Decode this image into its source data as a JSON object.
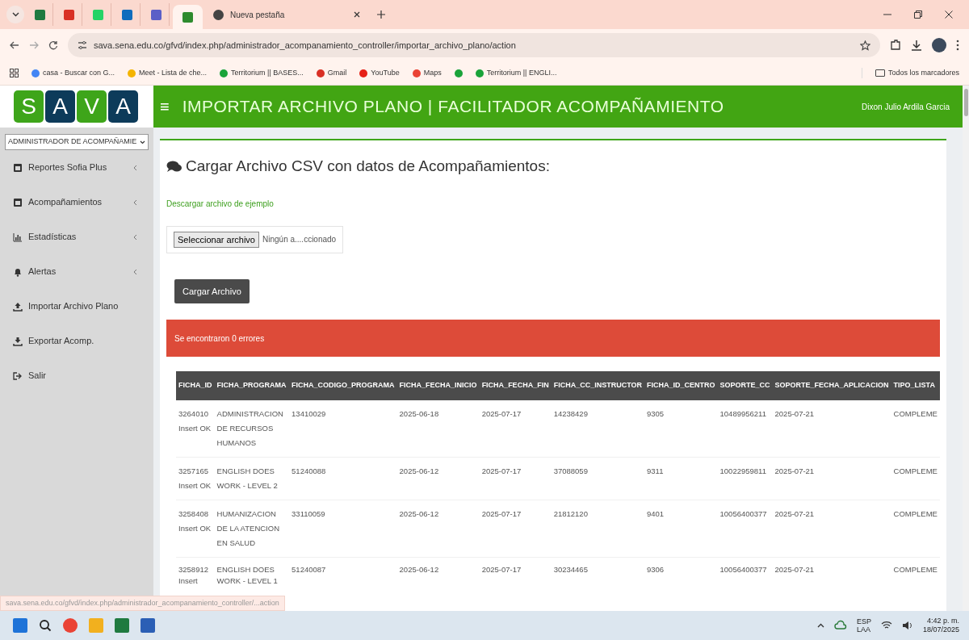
{
  "browser": {
    "tabs": [
      {
        "kind": "excel",
        "selected": false
      },
      {
        "kind": "gmail",
        "selected": false
      },
      {
        "kind": "whatsapp",
        "selected": false
      },
      {
        "kind": "outlook",
        "selected": false
      },
      {
        "kind": "teams",
        "selected": false
      },
      {
        "kind": "sava",
        "selected": true
      },
      {
        "kind": "chrome",
        "title": "Nueva pestaña",
        "selected": false
      }
    ],
    "url": "sava.sena.edu.co/gfvd/index.php/administrador_acompanamiento_controller/importar_archivo_plano/action",
    "bookmarks": [
      {
        "kind": "google",
        "label": "casa - Buscar con G..."
      },
      {
        "kind": "meet",
        "label": "Meet - Lista de che..."
      },
      {
        "kind": "territorium",
        "label": "Territorium || BASES..."
      },
      {
        "kind": "gmail",
        "label": "Gmail"
      },
      {
        "kind": "youtube",
        "label": "YouTube"
      },
      {
        "kind": "maps",
        "label": "Maps"
      },
      {
        "kind": "territorium"
      },
      {
        "kind": "territorium",
        "label": "Territorium || ENGLI..."
      }
    ],
    "all_bookmarks": "Todos los marcadores",
    "status_url": "sava.sena.edu.co/gfvd/index.php/administrador_acompanamiento_controller/...action"
  },
  "logo": [
    "S",
    "A",
    "V",
    "A"
  ],
  "header": {
    "menu_icon": "≡",
    "title": "IMPORTAR ARCHIVO PLANO | FACILITADOR ACOMPAÑAMIENTO",
    "user": "Dixon Julio Ardila Garcia"
  },
  "sidebar": {
    "role": "ADMINISTRADOR DE ACOMPAÑAMIE",
    "items": [
      {
        "kind": "report",
        "label": "Reportes Sofia Plus",
        "expandable": true
      },
      {
        "kind": "report",
        "label": "Acompañamientos",
        "expandable": true
      },
      {
        "kind": "chart",
        "label": "Estadísticas",
        "expandable": true
      },
      {
        "kind": "bell",
        "label": "Alertas",
        "expandable": true
      },
      {
        "kind": "upload",
        "label": "Importar Archivo Plano",
        "expandable": false
      },
      {
        "kind": "download",
        "label": "Exportar Acomp.",
        "expandable": false
      },
      {
        "kind": "logout",
        "label": "Salir",
        "expandable": false
      }
    ]
  },
  "content": {
    "title": "Cargar Archivo CSV con datos de Acompañamientos:",
    "example_link": "Descargar archivo de ejemplo",
    "file_button": "Seleccionar archivo",
    "file_status": "Ningún a....ccionado",
    "upload_button": "Cargar Archivo",
    "alert": "Se encontraron 0 errores",
    "table": {
      "columns": [
        "FICHA_ID",
        "FICHA_PROGRAMA",
        "FICHA_CODIGO_PROGRAMA",
        "FICHA_FECHA_INICIO",
        "FICHA_FECHA_FIN",
        "FICHA_CC_INSTRUCTOR",
        "FICHA_ID_CENTRO",
        "SOPORTE_CC",
        "SOPORTE_FECHA_APLICACION",
        "TIPO_LISTA"
      ],
      "rows": [
        [
          "3264010 Insert OK",
          "ADMINISTRACION DE RECURSOS HUMANOS",
          "13410029",
          "2025-06-18",
          "2025-07-17",
          "14238429",
          "9305",
          "10489956211",
          "2025-07-21",
          "COMPLEME"
        ],
        [
          "3257165 Insert OK",
          "ENGLISH DOES WORK - LEVEL 2",
          "51240088",
          "2025-06-12",
          "2025-07-17",
          "37088059",
          "9311",
          "10022959811",
          "2025-07-21",
          "COMPLEME"
        ],
        [
          "3258408 Insert OK",
          "HUMANIZACION DE LA ATENCION EN SALUD",
          "33110059",
          "2025-06-12",
          "2025-07-17",
          "21812120",
          "9401",
          "10056400377",
          "2025-07-21",
          "COMPLEME"
        ],
        [
          "3258912 Insert",
          "ENGLISH DOES WORK - LEVEL 1",
          "51240087",
          "2025-06-12",
          "2025-07-17",
          "30234465",
          "9306",
          "10056400377",
          "2025-07-21",
          "COMPLEME"
        ]
      ]
    }
  },
  "taskbar": {
    "language": "ESP",
    "layout": "LAA",
    "time": "4:42 p. m.",
    "date": "18/07/2025"
  }
}
